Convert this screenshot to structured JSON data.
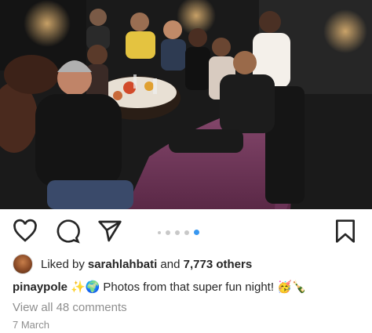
{
  "post": {
    "likes": {
      "prefix": "Liked by ",
      "liker": "sarahlahbati",
      "middle": " and ",
      "others": "7,773 others"
    },
    "caption": {
      "username": "pinaypole",
      "emoji_before": "✨🌍",
      "text": "Photos from that super fun night!",
      "emoji_after": "🥳🍾"
    },
    "comments_link": "View all 48 comments",
    "date": "7 March",
    "carousel": {
      "total": 5,
      "active_index": 4
    }
  },
  "icons": {
    "like": "heart-icon",
    "comment": "comment-icon",
    "share": "paper-plane-icon",
    "save": "bookmark-icon"
  },
  "colors": {
    "active_dot": "#3897f0",
    "sofa": "#7a3f63",
    "muted_text": "#8e8e8e"
  }
}
